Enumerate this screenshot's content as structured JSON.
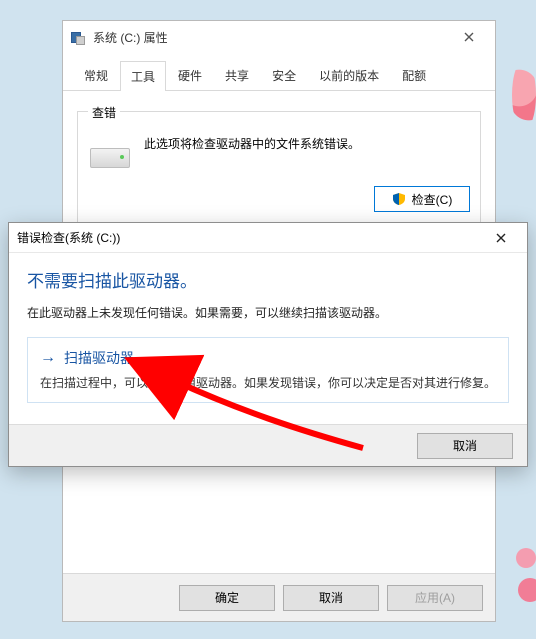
{
  "background_decor": {
    "flowers": true
  },
  "propertiesWindow": {
    "title": "系统 (C:) 属性",
    "tabs": [
      "常规",
      "工具",
      "硬件",
      "共享",
      "安全",
      "以前的版本",
      "配额"
    ],
    "activeTabIndex": 1,
    "toolsPanel": {
      "errorChecking": {
        "groupTitle": "查错",
        "description": "此选项将检查驱动器中的文件系统错误。",
        "checkButton": "检查(C)"
      }
    },
    "footer": {
      "ok": "确定",
      "cancel": "取消",
      "apply": "应用(A)"
    }
  },
  "errorCheckModal": {
    "title": "错误检查(系统 (C:))",
    "heading": "不需要扫描此驱动器。",
    "description": "在此驱动器上未发现任何错误。如果需要，可以继续扫描该驱动器。",
    "option": {
      "title": "扫描驱动器",
      "description": "在扫描过程中，可以继续使用驱动器。如果发现错误，你可以决定是否对其进行修复。"
    },
    "cancel": "取消"
  }
}
